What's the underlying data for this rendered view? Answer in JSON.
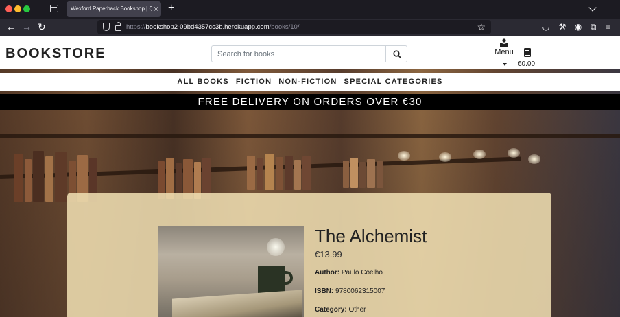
{
  "browser": {
    "tab_title": "Wexford Paperback Bookshop | Qua",
    "url_prefix": "https://",
    "url_host": "bookshop2-09bd4357cc3b.herokuapp.com",
    "url_path": "/books/10/"
  },
  "header": {
    "logo": "BOOKSTORE",
    "search_placeholder": "Search for books",
    "menu_label": "Menu",
    "bag_total": "€0.00"
  },
  "nav": {
    "links": [
      "ALL BOOKS",
      "FICTION",
      "NON-FICTION",
      "SPECIAL CATEGORIES"
    ]
  },
  "promo": "FREE DELIVERY ON ORDERS OVER €30",
  "book": {
    "title": "The Alchemist",
    "price": "€13.99",
    "author_label": "Author:",
    "author": "Paulo Coelho",
    "isbn_label": "ISBN:",
    "isbn": "9780062315007",
    "category_label": "Category:",
    "category": "Other"
  }
}
